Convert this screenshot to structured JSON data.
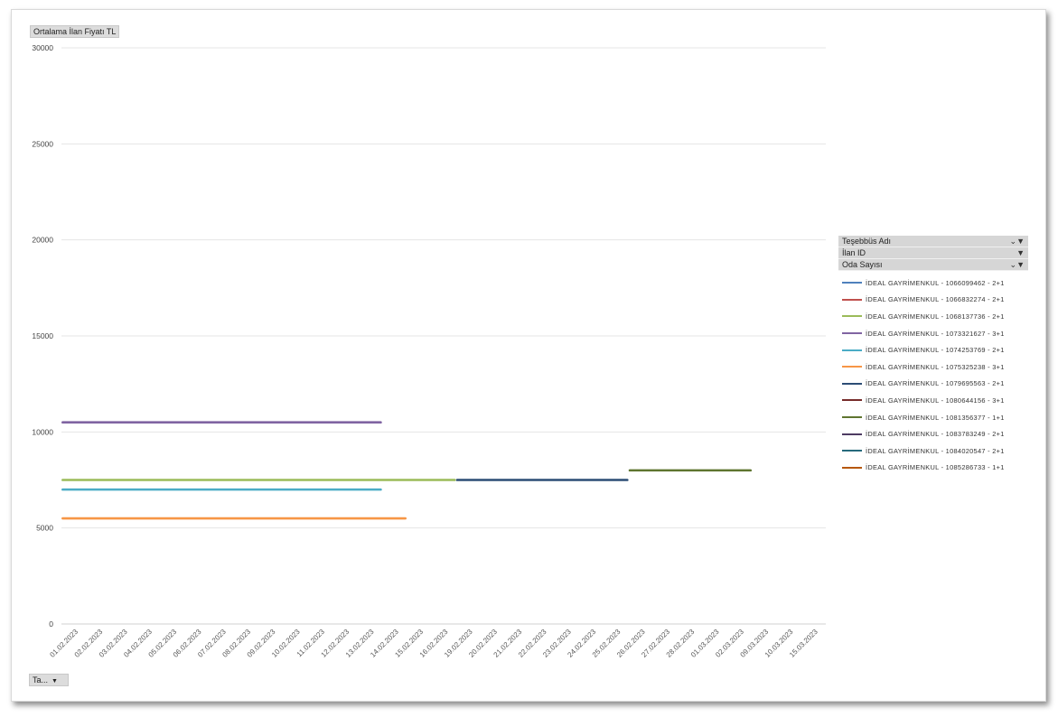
{
  "y_field_label": "Ortalama İlan Fiyatı TL",
  "x_field_label": "Ta...",
  "legend_fields": [
    {
      "label": "Teşebbüs Adı",
      "icon": "filter-icon",
      "glyph": "⌄▼"
    },
    {
      "label": "İlan ID",
      "icon": "dropdown-icon",
      "glyph": "▼"
    },
    {
      "label": "Oda Sayısı",
      "icon": "filter-icon",
      "glyph": "⌄▼"
    }
  ],
  "chart_data": {
    "type": "line",
    "categories": [
      "01.02.2023",
      "02.02.2023",
      "03.02.2023",
      "04.02.2023",
      "05.02.2023",
      "06.02.2023",
      "07.02.2023",
      "08.02.2023",
      "09.02.2023",
      "10.02.2023",
      "11.02.2023",
      "12.02.2023",
      "13.02.2023",
      "14.02.2023",
      "15.02.2023",
      "16.02.2023",
      "19.02.2023",
      "20.02.2023",
      "21.02.2023",
      "22.02.2023",
      "23.02.2023",
      "24.02.2023",
      "25.02.2023",
      "26.02.2023",
      "27.02.2023",
      "28.02.2023",
      "01.03.2023",
      "02.03.2023",
      "09.03.2023",
      "10.03.2023",
      "15.03.2023"
    ],
    "yticks": [
      "0",
      "5000",
      "10000",
      "15000",
      "20000",
      "25000",
      "30000"
    ],
    "ylim": [
      0,
      30000
    ],
    "grid": true,
    "legend_position": "right",
    "series": [
      {
        "name": "İDEAL GAYRİMENKUL - 1066099462 - 2+1",
        "color": "#4f81bd",
        "start": null,
        "end": null,
        "value": null
      },
      {
        "name": "İDEAL GAYRİMENKUL - 1066832274 - 2+1",
        "color": "#c0504d",
        "start": null,
        "end": null,
        "value": null
      },
      {
        "name": "İDEAL GAYRİMENKUL - 1068137736 - 2+1",
        "color": "#9bbb59",
        "start": 0,
        "end": 15,
        "value": 7500
      },
      {
        "name": "İDEAL GAYRİMENKUL - 1073321627 - 3+1",
        "color": "#8064a2",
        "start": 0,
        "end": 12,
        "value": 10500
      },
      {
        "name": "İDEAL GAYRİMENKUL - 1074253769 - 2+1",
        "color": "#4bacc6",
        "start": 0,
        "end": 12,
        "value": 7000
      },
      {
        "name": "İDEAL GAYRİMENKUL - 1075325238 - 3+1",
        "color": "#f79646",
        "start": 0,
        "end": 13,
        "value": 5500
      },
      {
        "name": "İDEAL GAYRİMENKUL - 1079695563 - 2+1",
        "color": "#2c4d75",
        "start": 16,
        "end": 22,
        "value": 7500
      },
      {
        "name": "İDEAL GAYRİMENKUL - 1080644156 - 3+1",
        "color": "#772c2a",
        "start": null,
        "end": null,
        "value": null
      },
      {
        "name": "İDEAL GAYRİMENKUL - 1081356377 - 1+1",
        "color": "#5f7530",
        "start": 23,
        "end": 27,
        "value": 8000
      },
      {
        "name": "İDEAL GAYRİMENKUL - 1083783249 - 2+1",
        "color": "#4d3b62",
        "start": null,
        "end": null,
        "value": null
      },
      {
        "name": "İDEAL GAYRİMENKUL - 1084020547 - 2+1",
        "color": "#276a7c",
        "start": null,
        "end": null,
        "value": null
      },
      {
        "name": "İDEAL GAYRİMENKUL - 1085286733 - 1+1",
        "color": "#b65708",
        "start": null,
        "end": null,
        "value": null
      }
    ]
  }
}
